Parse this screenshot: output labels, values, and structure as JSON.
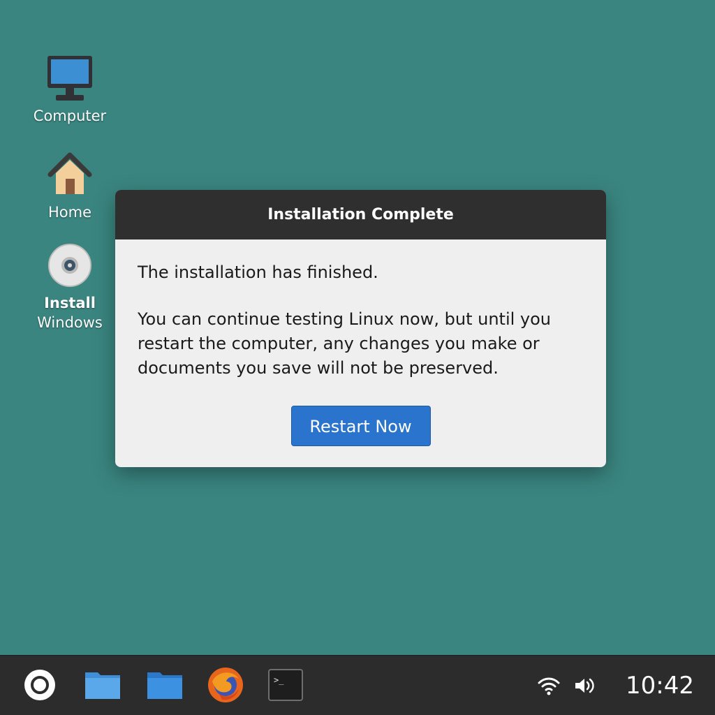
{
  "desktop": {
    "background": "#3a8580",
    "icons": [
      {
        "label": "Computer",
        "icon": "computer-icon"
      },
      {
        "label": "Home",
        "icon": "home-icon"
      },
      {
        "label_line1": "Install",
        "label_line2": "Windows",
        "icon": "disc-icon"
      }
    ]
  },
  "dialog": {
    "title": "Installation Complete",
    "message_1": "The installation has finished.",
    "message_2": "You can continue testing Linux now, but until you restart the computer, any changes you make or documents you save will not be preserved.",
    "button_label": "Restart Now",
    "button_color": "#2b74cd"
  },
  "taskbar": {
    "launchers": [
      {
        "icon": "menu-icon"
      },
      {
        "icon": "folder-icon"
      },
      {
        "icon": "folder-icon"
      },
      {
        "icon": "firefox-icon"
      },
      {
        "icon": "terminal-icon"
      }
    ],
    "terminal_prompt": ">_",
    "tray": {
      "wifi": "wifi-icon",
      "volume": "volume-icon",
      "clock": "10:42"
    }
  }
}
